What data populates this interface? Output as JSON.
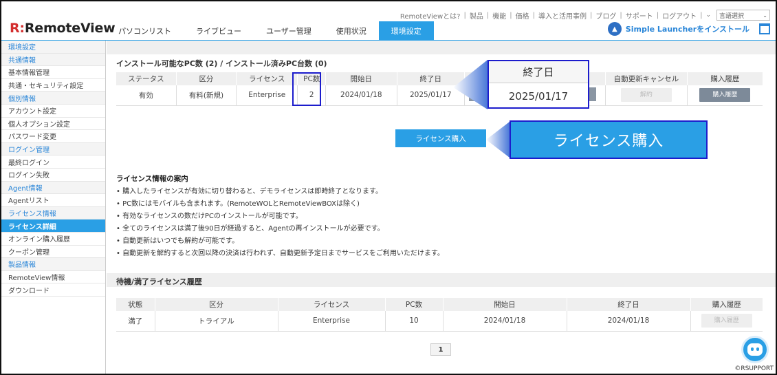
{
  "top_links": [
    "RemoteViewとは?",
    "製品",
    "機能",
    "価格",
    "導入と活用事例",
    "ブログ",
    "サポート",
    "ログアウト"
  ],
  "language_select": {
    "value": "言語選択"
  },
  "logo": {
    "mark": "R:",
    "text": "RemoteView"
  },
  "nav": {
    "tabs": [
      {
        "label": "パソコンリスト",
        "active": false
      },
      {
        "label": "ライブビュー",
        "active": false
      },
      {
        "label": "ユーザー管理",
        "active": false
      },
      {
        "label": "使用状況",
        "active": false
      },
      {
        "label": "環境設定",
        "active": true
      }
    ]
  },
  "launcher": {
    "label": "Simple Launcherをインストール"
  },
  "sidebar": {
    "items": [
      {
        "label": "環境設定",
        "type": "section"
      },
      {
        "label": "共通情報",
        "type": "section"
      },
      {
        "label": "基本情報管理",
        "type": "item"
      },
      {
        "label": "共通・セキュリティ設定",
        "type": "item"
      },
      {
        "label": "個別情報",
        "type": "section"
      },
      {
        "label": "アカウント設定",
        "type": "item"
      },
      {
        "label": "個人オプション設定",
        "type": "item"
      },
      {
        "label": "パスワード変更",
        "type": "item"
      },
      {
        "label": "ログイン管理",
        "type": "section"
      },
      {
        "label": "最終ログイン",
        "type": "item"
      },
      {
        "label": "ログイン失敗",
        "type": "item"
      },
      {
        "label": "Agent情報",
        "type": "section"
      },
      {
        "label": "Agentリスト",
        "type": "item"
      },
      {
        "label": "ライセンス情報",
        "type": "section"
      },
      {
        "label": "ライセンス詳細",
        "type": "active"
      },
      {
        "label": "オンライン購入履歴",
        "type": "item"
      },
      {
        "label": "クーポン管理",
        "type": "item"
      },
      {
        "label": "製品情報",
        "type": "section"
      },
      {
        "label": "RemoteView情報",
        "type": "item"
      },
      {
        "label": "ダウンロード",
        "type": "item"
      }
    ]
  },
  "license_section": {
    "title": "インストール可能なPC数 (2) / インストール済みPC台数 (0)",
    "headers": [
      "ステータス",
      "区分",
      "ライセンス",
      "PC数",
      "開始日",
      "終了日",
      "",
      "",
      "自動更新キャンセル",
      "購入履歴"
    ],
    "row": {
      "status": "有効",
      "category": "有料(新規)",
      "license": "Enterprise",
      "pc_count": "2",
      "start_date": "2024/01/18",
      "end_date": "2025/01/17",
      "cancel_button": "解約",
      "history_button": "購入履歴"
    }
  },
  "callout_end_date": {
    "header": "終了日",
    "value": "2025/01/17"
  },
  "purchase_button": {
    "label": "ライセンス購入"
  },
  "purchase_callout": {
    "label": "ライセンス購入"
  },
  "guide": {
    "title": "ライセンス情報の案内",
    "items": [
      "購入したライセンスが有効に切り替わると、デモライセンスは即時終了となります。",
      "PC数にはモバイルも含まれます。(RemoteWOLとRemoteViewBOXは除く)",
      "有効なライセンスの数だけPCのインストールが可能です。",
      "全てのライセンスは満了後90日が経過すると、Agentの再インストールが必要です。",
      "自動更新はいつでも解約が可能です。",
      "自動更新を解約すると次回以降の決済は行われず、自動更新予定日までサービスをご利用いただけます。"
    ]
  },
  "history_section": {
    "title": "待機/満了ライセンス履歴",
    "headers": [
      "状態",
      "区分",
      "ライセンス",
      "PC数",
      "開始日",
      "終了日",
      "購入履歴"
    ],
    "rows": [
      {
        "status": "満了",
        "category": "トライアル",
        "license": "Enterprise",
        "pc_count": "10",
        "start_date": "2024/01/18",
        "end_date": "2024/01/18",
        "history_button": "購入履歴"
      }
    ]
  },
  "pager": {
    "current": "1"
  },
  "copyright": "©RSUPPORT",
  "colors": {
    "accent": "#2a9fe5",
    "highlight_border": "#1c1ccc",
    "brand_red": "#d32d2d"
  }
}
